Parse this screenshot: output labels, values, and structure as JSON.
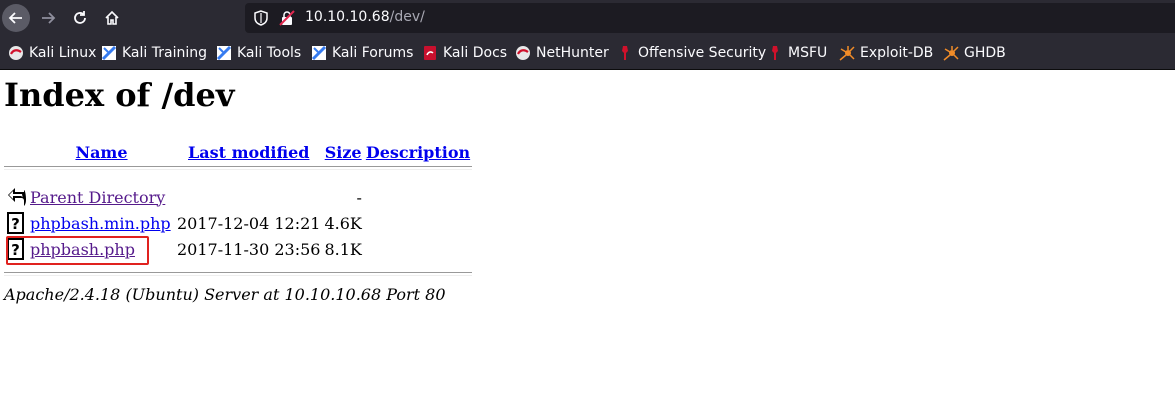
{
  "browser": {
    "url_host": "10.10.10.68",
    "url_path": "/dev/",
    "bookmarks": [
      {
        "label": "Kali Linux",
        "icon": "kali-dragon-icon"
      },
      {
        "label": "Kali Training",
        "icon": "kali-training-icon"
      },
      {
        "label": "Kali Tools",
        "icon": "kali-tools-icon"
      },
      {
        "label": "Kali Forums",
        "icon": "kali-forums-icon"
      },
      {
        "label": "Kali Docs",
        "icon": "kali-docs-icon"
      },
      {
        "label": "NetHunter",
        "icon": "nethunter-icon"
      },
      {
        "label": "Offensive Security",
        "icon": "offsec-icon"
      },
      {
        "label": "MSFU",
        "icon": "msfu-icon"
      },
      {
        "label": "Exploit-DB",
        "icon": "exploit-db-spider-icon"
      },
      {
        "label": "GHDB",
        "icon": "ghdb-spider-icon"
      }
    ]
  },
  "page": {
    "title": "Index of /dev",
    "columns": {
      "name": "Name",
      "last_modified": "Last modified",
      "size": "Size",
      "description": "Description"
    },
    "rows": [
      {
        "name": "Parent Directory",
        "modified": "",
        "size": "-",
        "description": "",
        "icon": "back-arrow-icon"
      },
      {
        "name": "phpbash.min.php",
        "modified": "2017-12-04 12:21",
        "size": "4.6K",
        "description": "",
        "icon": "unknown-file-icon"
      },
      {
        "name": "phpbash.php",
        "modified": "2017-11-30 23:56",
        "size": "8.1K",
        "description": "",
        "icon": "unknown-file-icon"
      }
    ],
    "footer": "Apache/2.4.18 (Ubuntu) Server at 10.10.10.68 Port 80"
  },
  "colors": {
    "link": "#0000ee",
    "visited": "#551a8b",
    "highlight_box": "#e0221f",
    "chrome_bg": "#2b2a33"
  }
}
